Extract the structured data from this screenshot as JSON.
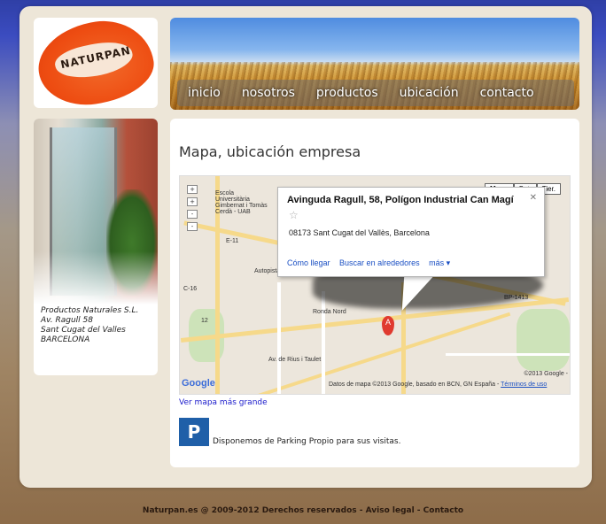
{
  "logo": {
    "text": "NATURPAN"
  },
  "nav": {
    "items": [
      "inicio",
      "nosotros",
      "productos",
      "ubicación",
      "contacto"
    ]
  },
  "sidebar": {
    "address_lines": [
      "Productos Naturales S.L.",
      "Av. Ragull 58",
      "Sant Cugat del Valles",
      "BARCELONA"
    ]
  },
  "main": {
    "title": "Mapa, ubicación empresa",
    "map": {
      "type_buttons": [
        "Mapa",
        "Sat.",
        "Tier."
      ],
      "info_title": "Avinguda Ragull, 58, Polígon Industrial Can Magí",
      "info_address": "08173 Sant Cugat del Vallès, Barcelona",
      "info_links": [
        "Cómo llegar",
        "Buscar en alrededores",
        "más ▾"
      ],
      "marker_label": "A",
      "place_labels": [
        "Escola Universitària Gimbernat i Tomàs Cerdà - UAB",
        "Autopista",
        "Ronda Nord",
        "Av. de Rius i Taulet",
        "BP-1413",
        "E-11",
        "C-16",
        "12"
      ],
      "copyright": "©2013 Google -",
      "footer_text": "Datos de mapa ©2013 Google, basado en BCN, GN España -",
      "footer_link": "Términos de uso",
      "google_text": "Google"
    },
    "bigmap_link": "Ver mapa más grande",
    "parking_icon": "P",
    "parking_text": "Disponemos de Parking Propio para sus visitas."
  },
  "footer": {
    "text": "Naturpan.es @ 2009-2012 Derechos reservados - Aviso legal - Contacto"
  }
}
